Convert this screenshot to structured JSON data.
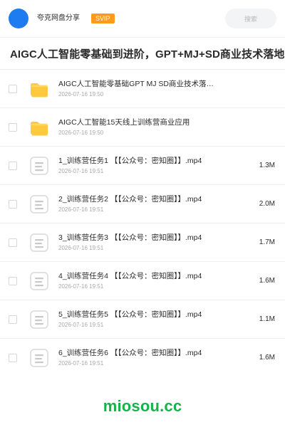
{
  "colors": {
    "avatar": "#1f7cf0",
    "svip": "#ff9a1a",
    "watermark": "#18b24a",
    "folder": "#ffc93d"
  },
  "header": {
    "title": "夸克网盘分享",
    "badge": "SVIP",
    "search_label": "搜索"
  },
  "page": {
    "title": "AIGC人工智能零基础到进阶，GPT+MJ+SD商业技术落地，"
  },
  "files": [
    {
      "icon": "folder-icon",
      "name": "AIGC人工智能零基础GPT MJ SD商业技术落…",
      "date": "2026-07-16 19:50",
      "size": ""
    },
    {
      "icon": "folder-icon",
      "name": "AIGC人工智能15天线上训练营商业应用",
      "date": "2026-07-16 19:50",
      "size": ""
    },
    {
      "icon": "document-icon",
      "name": "1_训练营任务1 【【公众号：密知圈】】.mp4",
      "date": "2026-07-16 19:51",
      "size": "1.3M"
    },
    {
      "icon": "document-icon",
      "name": "2_训练营任务2 【【公众号：密知圈】】.mp4",
      "date": "2026-07-16 19:51",
      "size": "2.0M"
    },
    {
      "icon": "document-icon",
      "name": "3_训练营任务3 【【公众号：密知圈】】.mp4",
      "date": "2026-07-16 19:51",
      "size": "1.7M"
    },
    {
      "icon": "document-icon",
      "name": "4_训练营任务4 【【公众号：密知圈】】.mp4",
      "date": "2026-07-16 19:51",
      "size": "1.6M"
    },
    {
      "icon": "document-icon",
      "name": "5_训练营任务5 【【公众号：密知圈】】.mp4",
      "date": "2026-07-16 19:51",
      "size": "1.1M"
    },
    {
      "icon": "document-icon",
      "name": "6_训练营任务6 【【公众号：密知圈】】.mp4",
      "date": "2026-07-16 19:51",
      "size": "1.6M"
    }
  ],
  "watermark": {
    "text": "miosou.cc"
  }
}
